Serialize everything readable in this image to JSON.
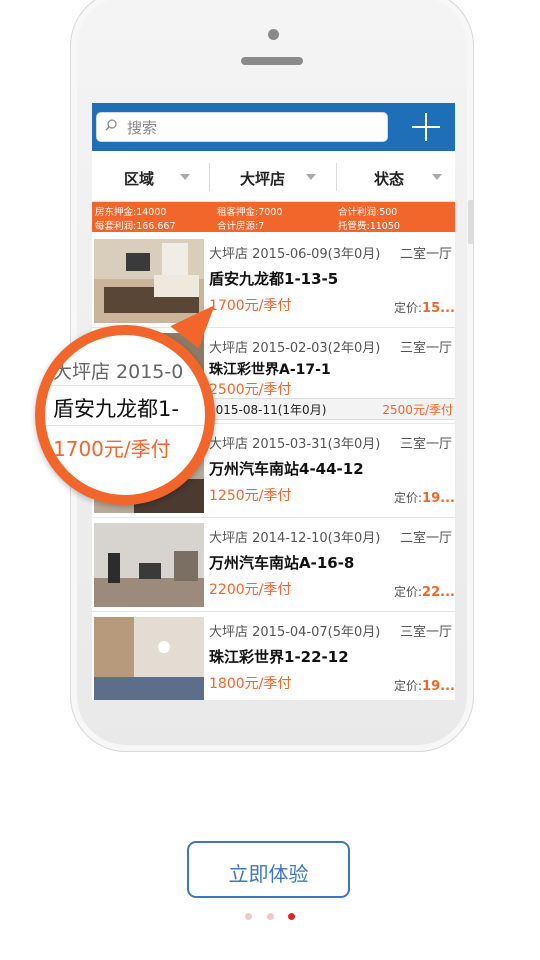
{
  "search": {
    "placeholder": "搜索"
  },
  "filters": [
    "区域",
    "大坪店",
    "状态"
  ],
  "stats": {
    "deposit_house": "房东押金:14000",
    "deposit_tenant": "租客押金:7000",
    "total_profit": "合计利润:500",
    "per_unit_profit": "每套利润:166.667",
    "total_units": "合计房源:7",
    "mgmt_fee": "托管费:11050"
  },
  "listings": [
    {
      "store_date": "大坪店  2015-06-09(3年0月)",
      "room": "二室一厅",
      "name": "盾安九龙都1-13-5",
      "price": "1700元/季付",
      "fixed_label": "定价:",
      "fixed_value": "15..."
    },
    {
      "store_date": "大坪店  2015-02-03(2年0月)",
      "room": "三室一厅",
      "name": "珠江彩世界A-17-1",
      "price": "2500元/季付",
      "extra_date": "2015-08-11(1年0月)",
      "extra_price": "2500元/季付"
    },
    {
      "store_date": "大坪店  2015-03-31(3年0月)",
      "room": "三室一厅",
      "name": "万州汽车南站4-44-12",
      "price": "1250元/季付",
      "fixed_label": "定价:",
      "fixed_value": "19..."
    },
    {
      "store_date": "大坪店  2014-12-10(3年0月)",
      "room": "二室一厅",
      "name": "万州汽车南站A-16-8",
      "price": "2200元/季付",
      "fixed_label": "定价:",
      "fixed_value": "22..."
    },
    {
      "store_date": "大坪店  2015-04-07(5年0月)",
      "room": "三室一厅",
      "name": "珠江彩世界1-22-12",
      "price": "1800元/季付",
      "fixed_label": "定价:",
      "fixed_value": "19..."
    }
  ],
  "magnifier": {
    "top": "大坪店  2015-0",
    "name": "盾安九龙都1-",
    "price": "1700元/季付"
  },
  "cta": {
    "label": "立即体验"
  },
  "pagination": {
    "count": 3,
    "active": 3
  },
  "colors": {
    "accent": "#f2662b",
    "brand": "#1e6fb8",
    "cta": "#3e76c4"
  }
}
